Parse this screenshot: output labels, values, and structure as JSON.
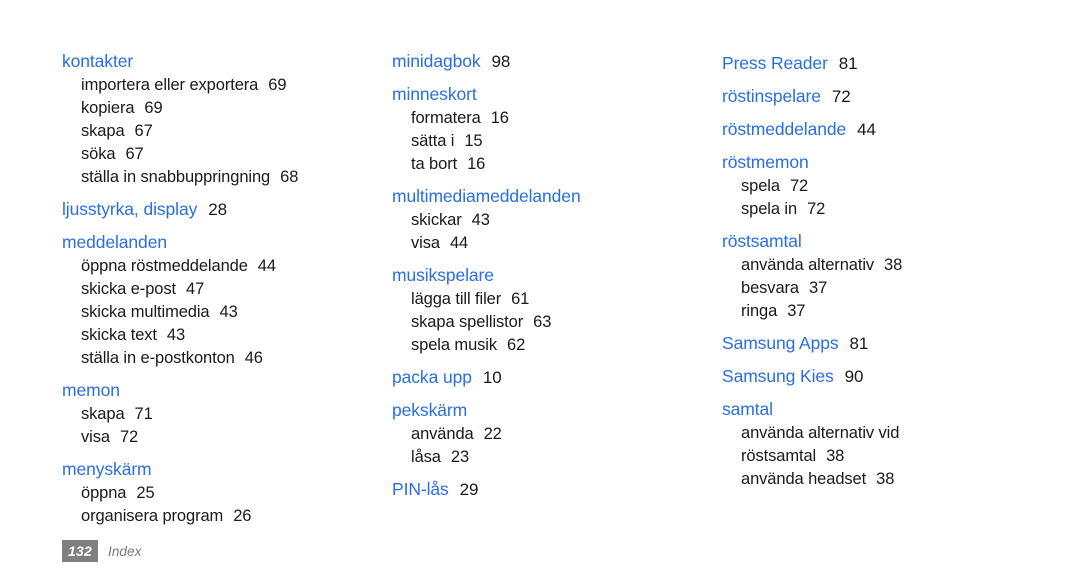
{
  "document": {
    "type": "index-page",
    "language": "sv",
    "heading_color": "#2a6fe0",
    "text_color": "#1a1a1a",
    "background_color": "#ffffff",
    "badge_color": "#7f7f7f"
  },
  "footer": {
    "page_number": "132",
    "section_label": "Index"
  },
  "columns": [
    {
      "id": "column-1",
      "groups": [
        {
          "heading": "kontakter",
          "heading_page": "",
          "subentries": [
            {
              "label": "importera eller exportera",
              "page": "69"
            },
            {
              "label": "kopiera",
              "page": "69"
            },
            {
              "label": "skapa",
              "page": "67"
            },
            {
              "label": "söka",
              "page": "67"
            },
            {
              "label": "ställa in snabbuppringning",
              "page": "68"
            }
          ]
        },
        {
          "heading": "ljusstyrka, display",
          "heading_page": "28",
          "subentries": []
        },
        {
          "heading": "meddelanden",
          "heading_page": "",
          "subentries": [
            {
              "label": "öppna röstmeddelande",
              "page": "44"
            },
            {
              "label": "skicka e-post",
              "page": "47"
            },
            {
              "label": "skicka multimedia",
              "page": "43"
            },
            {
              "label": "skicka text",
              "page": "43"
            },
            {
              "label": "ställa in e-postkonton",
              "page": "46"
            }
          ]
        },
        {
          "heading": "memon",
          "heading_page": "",
          "subentries": [
            {
              "label": "skapa",
              "page": "71"
            },
            {
              "label": "visa",
              "page": "72"
            }
          ]
        },
        {
          "heading": "menyskärm",
          "heading_page": "",
          "subentries": [
            {
              "label": "öppna",
              "page": "25"
            },
            {
              "label": "organisera program",
              "page": "26"
            }
          ]
        }
      ]
    },
    {
      "id": "column-2",
      "groups": [
        {
          "heading": "minidagbok",
          "heading_page": "98",
          "subentries": []
        },
        {
          "heading": "minneskort",
          "heading_page": "",
          "subentries": [
            {
              "label": "formatera",
              "page": "16"
            },
            {
              "label": "sätta i",
              "page": "15"
            },
            {
              "label": "ta bort",
              "page": "16"
            }
          ]
        },
        {
          "heading": "multimediameddelanden",
          "heading_page": "",
          "subentries": [
            {
              "label": "skickar",
              "page": "43"
            },
            {
              "label": "visa",
              "page": "44"
            }
          ]
        },
        {
          "heading": "musikspelare",
          "heading_page": "",
          "subentries": [
            {
              "label": "lägga till filer",
              "page": "61"
            },
            {
              "label": "skapa spellistor",
              "page": "63"
            },
            {
              "label": "spela musik",
              "page": "62"
            }
          ]
        },
        {
          "heading": "packa upp",
          "heading_page": "10",
          "subentries": []
        },
        {
          "heading": "pekskärm",
          "heading_page": "",
          "subentries": [
            {
              "label": "använda",
              "page": "22"
            },
            {
              "label": "låsa",
              "page": "23"
            }
          ]
        },
        {
          "heading": "PIN-lås",
          "heading_page": "29",
          "subentries": []
        }
      ]
    },
    {
      "id": "column-3",
      "groups": [
        {
          "heading": "Press Reader",
          "heading_page": "81",
          "subentries": []
        },
        {
          "heading": "röstinspelare",
          "heading_page": "72",
          "subentries": []
        },
        {
          "heading": "röstmeddelande",
          "heading_page": "44",
          "subentries": []
        },
        {
          "heading": "röstmemon",
          "heading_page": "",
          "subentries": [
            {
              "label": "spela",
              "page": "72"
            },
            {
              "label": "spela in",
              "page": "72"
            }
          ]
        },
        {
          "heading": "röstsamtal",
          "heading_page": "",
          "subentries": [
            {
              "label": "använda alternativ",
              "page": "38"
            },
            {
              "label": "besvara",
              "page": "37"
            },
            {
              "label": "ringa",
              "page": "37"
            }
          ]
        },
        {
          "heading": "Samsung Apps",
          "heading_page": "81",
          "subentries": []
        },
        {
          "heading": "Samsung Kies",
          "heading_page": "90",
          "subentries": []
        },
        {
          "heading": "samtal",
          "heading_page": "",
          "subentries": [
            {
              "label": "använda alternativ vid röstsamtal",
              "page": "38",
              "wrap": true
            },
            {
              "label": "använda headset",
              "page": "38"
            }
          ]
        }
      ]
    }
  ]
}
